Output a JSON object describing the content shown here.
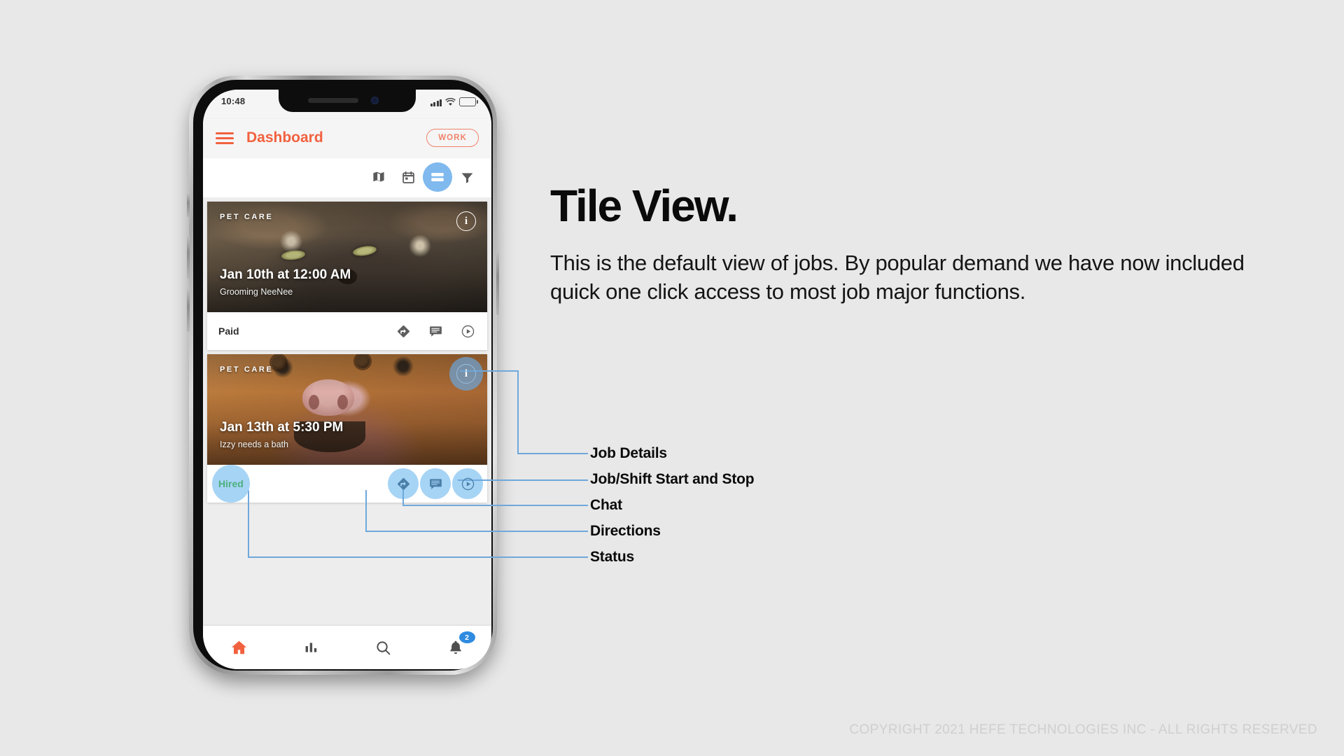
{
  "page": {
    "background_color": "#e8e8e8",
    "headline": "Tile View.",
    "body_copy": "This is the default view of jobs. By popular demand we have now included quick one click access to most job major functions.",
    "copyright": "COPYRIGHT 2021 HEFE TECHNOLOGIES INC - ALL RIGHTS RESERVED"
  },
  "phone": {
    "status_bar": {
      "time": "10:48",
      "signal_icon": "signal-bars-icon",
      "wifi_icon": "wifi-icon",
      "battery_icon": "battery-icon"
    },
    "header": {
      "menu_icon": "hamburger-menu-icon",
      "title": "Dashboard",
      "mode_badge": "WORK",
      "accent_color": "#f2613f"
    },
    "view_toolbar": {
      "items": [
        {
          "name": "map-view",
          "icon": "map-icon",
          "active": false
        },
        {
          "name": "calendar-view",
          "icon": "calendar-icon",
          "active": false
        },
        {
          "name": "tile-view",
          "icon": "tile-view-icon",
          "active": true
        },
        {
          "name": "filter",
          "icon": "filter-icon",
          "active": false
        }
      ],
      "active_color": "#7fb9ee"
    },
    "job_cards": [
      {
        "category": "PET CARE",
        "datetime": "Jan 10th at 12:00 AM",
        "description": "Grooming NeeNee",
        "status": "Paid",
        "status_color": "#2e2e2e",
        "info_icon": "info-icon",
        "info_highlighted": false,
        "status_highlighted": false,
        "actions": [
          {
            "name": "directions",
            "icon": "directions-icon",
            "highlighted": false
          },
          {
            "name": "chat",
            "icon": "chat-icon",
            "highlighted": false
          },
          {
            "name": "start-stop",
            "icon": "play-circle-icon",
            "highlighted": false
          }
        ]
      },
      {
        "category": "PET CARE",
        "datetime": "Jan 13th at 5:30 PM",
        "description": "Izzy needs a bath",
        "status": "Hired",
        "status_color": "#4caf7d",
        "info_icon": "info-icon",
        "info_highlighted": true,
        "status_highlighted": true,
        "actions": [
          {
            "name": "directions",
            "icon": "directions-icon",
            "highlighted": true
          },
          {
            "name": "chat",
            "icon": "chat-icon",
            "highlighted": true
          },
          {
            "name": "start-stop",
            "icon": "play-circle-icon",
            "highlighted": true
          }
        ]
      }
    ],
    "bottom_nav": [
      {
        "name": "home",
        "icon": "home-icon",
        "active": true,
        "badge": ""
      },
      {
        "name": "stats",
        "icon": "bar-chart-icon",
        "active": false,
        "badge": ""
      },
      {
        "name": "search",
        "icon": "search-icon",
        "active": false,
        "badge": ""
      },
      {
        "name": "notifications",
        "icon": "bell-icon",
        "active": false,
        "badge": "2"
      }
    ],
    "badge_color": "#2f8be0"
  },
  "callouts": {
    "line_color": "#6fa8dc",
    "items": [
      {
        "label": "Job Details"
      },
      {
        "label": "Job/Shift Start and Stop"
      },
      {
        "label": "Chat"
      },
      {
        "label": "Directions"
      },
      {
        "label": "Status"
      }
    ]
  }
}
